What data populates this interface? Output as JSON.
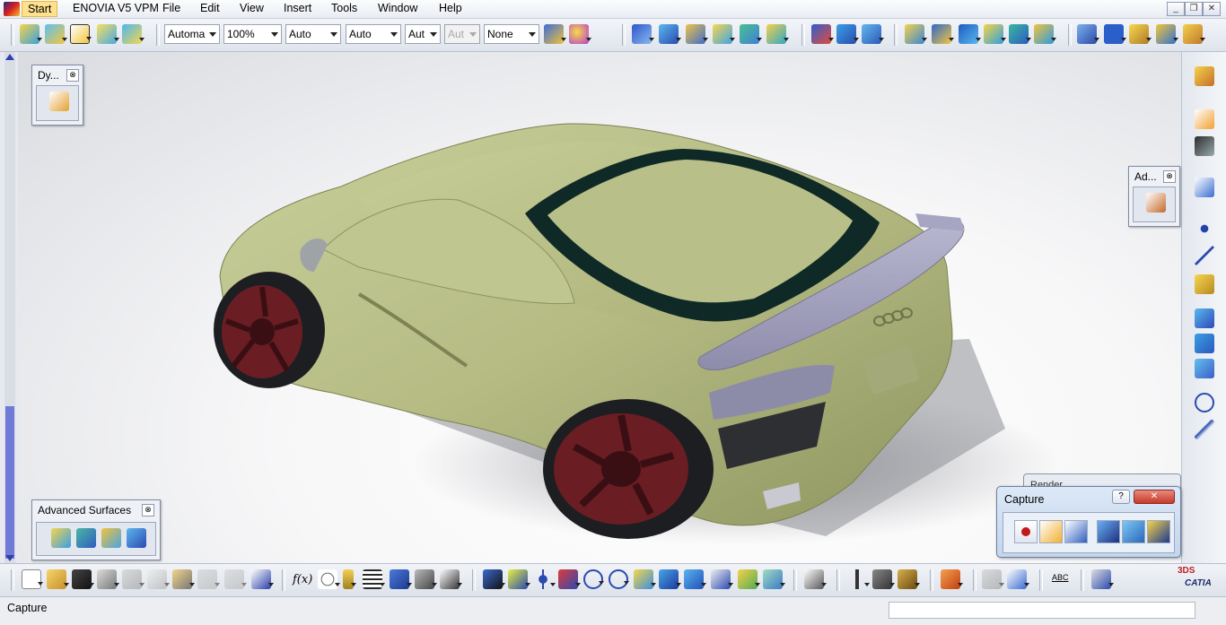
{
  "menubar": {
    "items": [
      {
        "label": "Start"
      },
      {
        "label": "ENOVIA V5 VPM"
      },
      {
        "label": "File"
      },
      {
        "label": "Edit"
      },
      {
        "label": "View"
      },
      {
        "label": "Insert"
      },
      {
        "label": "Tools"
      },
      {
        "label": "Window"
      },
      {
        "label": "Help"
      }
    ],
    "window_buttons": {
      "minimize": "_",
      "restore": "❐",
      "close": "✕"
    }
  },
  "toolbar": {
    "combos": [
      {
        "value": "Automa"
      },
      {
        "value": "100%"
      },
      {
        "value": "Auto"
      },
      {
        "value": "Auto"
      },
      {
        "value": "Aut"
      },
      {
        "value": "Aut"
      },
      {
        "value": "None"
      }
    ]
  },
  "palettes": {
    "dynamic_sketcher": {
      "title": "Dy...",
      "close": "⊗"
    },
    "advanced": {
      "title": "Ad...",
      "close": "⊗"
    },
    "advanced_surfaces": {
      "title": "Advanced Surfaces",
      "close": "⊗"
    }
  },
  "render_window": {
    "title": "Render"
  },
  "capture_dialog": {
    "title": "Capture",
    "help": "?",
    "close": "✕"
  },
  "bottombar": {
    "fx_label": "f(x)",
    "abc_label": "ABC",
    "brand": "CATIA",
    "brand_mark": "3DS"
  },
  "status": {
    "text": "Capture",
    "input_value": ""
  },
  "colors": {
    "car_body": "#b7bd86",
    "car_window": "#0f2a26",
    "spoiler": "#a9a8c4",
    "wheel_rim": "#6b1d24",
    "accent_blue": "#3040b0"
  }
}
